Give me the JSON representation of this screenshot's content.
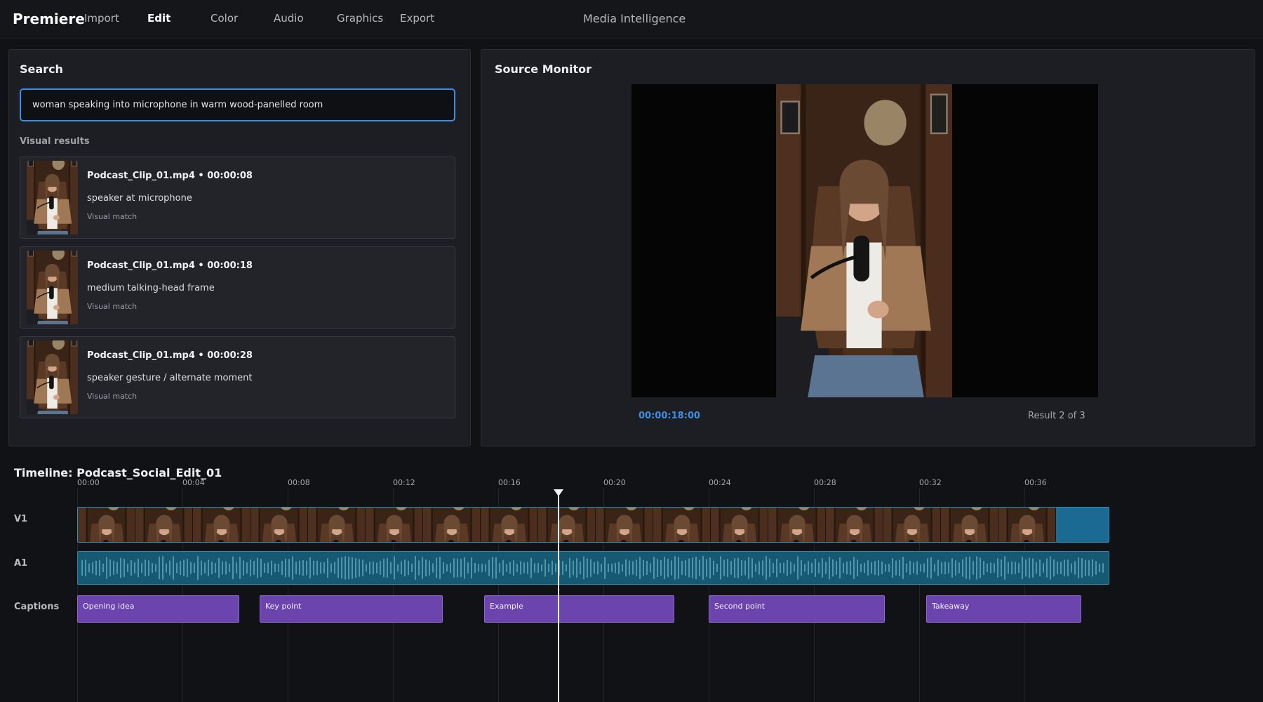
{
  "app": {
    "name": "Premiere"
  },
  "nav": {
    "items": [
      {
        "label": "Import",
        "active": false
      },
      {
        "label": "Edit",
        "active": true
      },
      {
        "label": "Color",
        "active": false
      },
      {
        "label": "Audio",
        "active": false
      },
      {
        "label": "Graphics",
        "active": false
      },
      {
        "label": "Export",
        "active": false
      }
    ],
    "media_intelligence": "Media Intelligence"
  },
  "search": {
    "title": "Search",
    "query": "woman speaking into microphone in warm wood-panelled room",
    "results_label": "Visual results",
    "results": [
      {
        "title": "Podcast_Clip_01.mp4 • 00:00:08",
        "description": "speaker at microphone",
        "match": "Visual match"
      },
      {
        "title": "Podcast_Clip_01.mp4 • 00:00:18",
        "description": "medium talking-head frame",
        "match": "Visual match"
      },
      {
        "title": "Podcast_Clip_01.mp4 • 00:00:28",
        "description": "speaker gesture / alternate moment",
        "match": "Visual match"
      }
    ]
  },
  "monitor": {
    "title": "Source Monitor",
    "timecode": "00:00:18:00",
    "result_count": "Result 2 of 3"
  },
  "timeline": {
    "title": "Timeline: Podcast_Social_Edit_01",
    "ruler": [
      "00:00",
      "00:04",
      "00:08",
      "00:12",
      "00:16",
      "00:20",
      "00:24",
      "00:28",
      "00:32",
      "00:36"
    ],
    "tracks": {
      "v1": "V1",
      "a1": "A1",
      "captions": "Captions"
    },
    "captions": [
      "Opening idea",
      "Key point",
      "Example",
      "Second point",
      "Takeaway"
    ],
    "playhead_seconds": 18.3
  },
  "colors": {
    "accent": "#3d8ee0",
    "video_clip": "#1b6a93",
    "audio_clip": "#155972",
    "caption_clip": "#6b45ad",
    "playhead": "#f2f2f2"
  },
  "icons": {
    "playhead": "playhead-marker-icon"
  }
}
